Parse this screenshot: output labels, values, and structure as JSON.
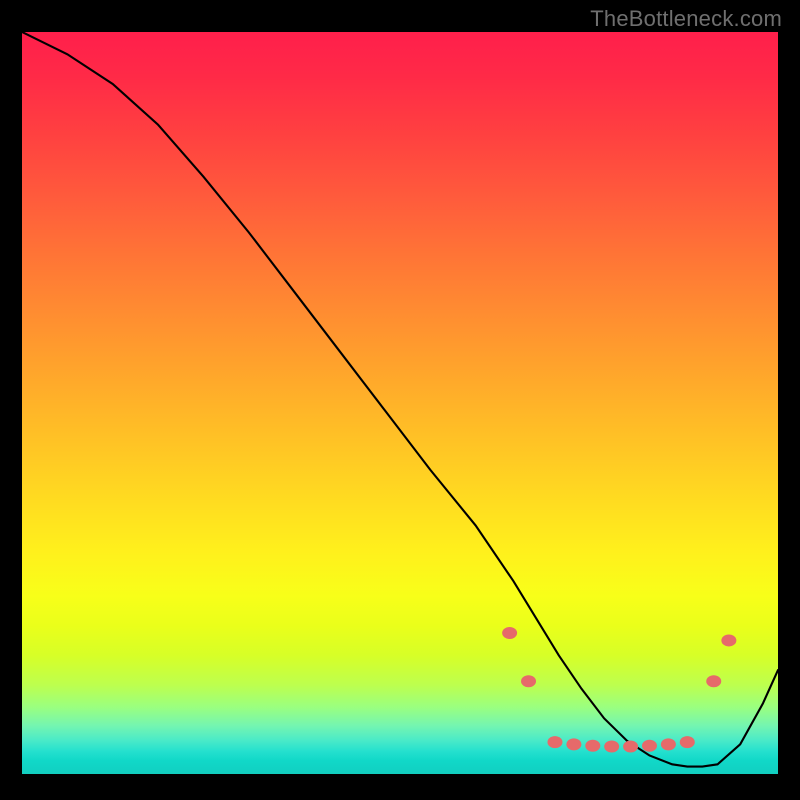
{
  "watermark": "TheBottleneck.com",
  "chart_data": {
    "type": "line",
    "title": "",
    "xlabel": "",
    "ylabel": "",
    "xlim": [
      0,
      100
    ],
    "ylim": [
      0,
      100
    ],
    "grid": false,
    "legend": false,
    "annotations": [],
    "series": [
      {
        "name": "bottleneck-curve",
        "x": [
          0,
          6,
          12,
          18,
          24,
          30,
          36,
          42,
          48,
          54,
          60,
          65,
          68,
          71,
          74,
          77,
          80,
          83,
          86,
          88,
          90,
          92,
          95,
          98,
          100
        ],
        "y": [
          100,
          97,
          93,
          87.5,
          80.5,
          73,
          65,
          57,
          49,
          41,
          33.5,
          26,
          21,
          16,
          11.5,
          7.5,
          4.5,
          2.5,
          1.3,
          1.0,
          1.0,
          1.3,
          4.0,
          9.5,
          14
        ]
      }
    ],
    "markers": {
      "name": "highlight-dots",
      "points": [
        {
          "x": 64.5,
          "y": 19.0
        },
        {
          "x": 67.0,
          "y": 12.5
        },
        {
          "x": 70.5,
          "y": 4.3
        },
        {
          "x": 73.0,
          "y": 4.0
        },
        {
          "x": 75.5,
          "y": 3.8
        },
        {
          "x": 78.0,
          "y": 3.7
        },
        {
          "x": 80.5,
          "y": 3.7
        },
        {
          "x": 83.0,
          "y": 3.8
        },
        {
          "x": 85.5,
          "y": 4.0
        },
        {
          "x": 88.0,
          "y": 4.3
        },
        {
          "x": 91.5,
          "y": 12.5
        },
        {
          "x": 93.5,
          "y": 18.0
        }
      ]
    },
    "background": {
      "type": "vertical-gradient",
      "stops": [
        {
          "pos": 0.0,
          "color": "#ff1f4b"
        },
        {
          "pos": 0.5,
          "color": "#ffbf26"
        },
        {
          "pos": 0.78,
          "color": "#f8ff19"
        },
        {
          "pos": 0.92,
          "color": "#74f5b1"
        },
        {
          "pos": 1.0,
          "color": "#12cfc0"
        }
      ]
    }
  }
}
